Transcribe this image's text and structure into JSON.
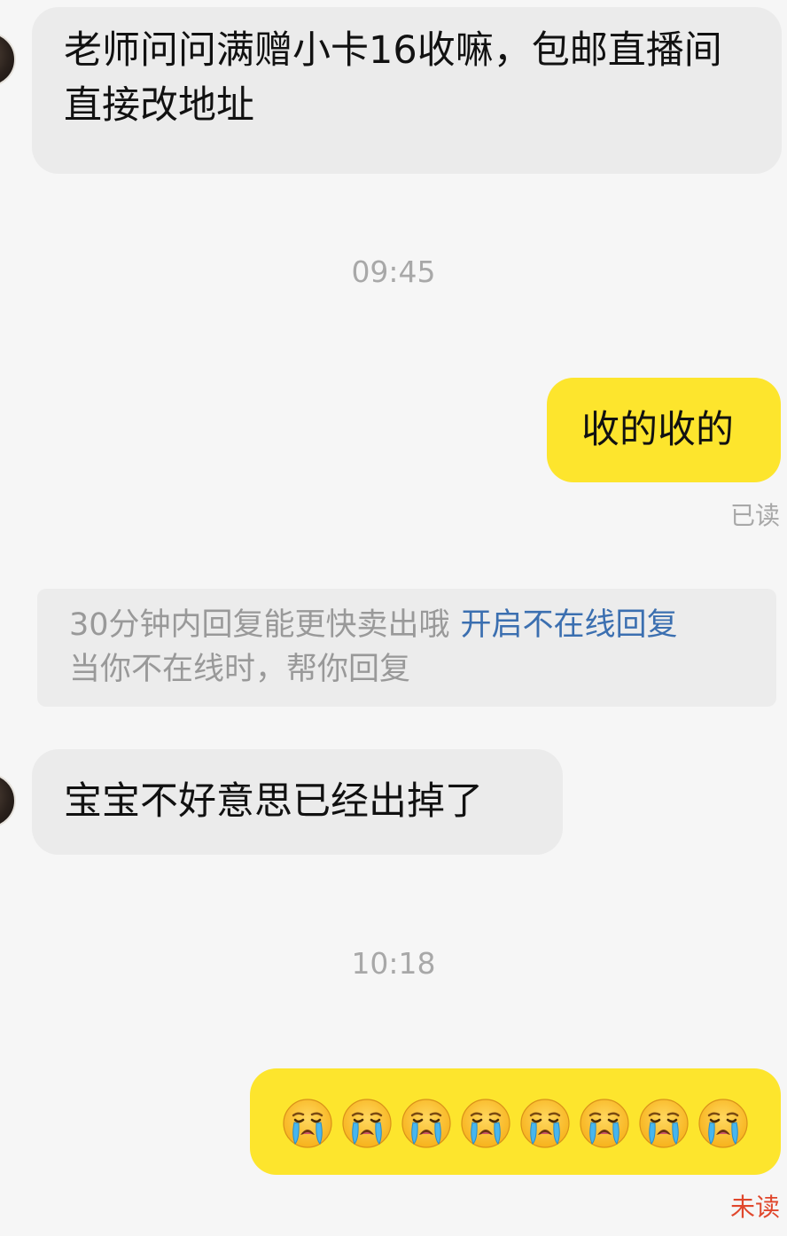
{
  "messages": {
    "m1": {
      "text": "老师问问满赠小卡16收嘛，包邮直播间直接改地址"
    },
    "t1": "09:45",
    "m2": {
      "text": "收的收的",
      "status": "已读"
    },
    "system": {
      "text": "30分钟内回复能更快卖出哦",
      "link": "开启不在线回复",
      "subtext": "当你不在线时，帮你回复"
    },
    "m3": {
      "text": "宝宝不好意思已经出掉了"
    },
    "t2": "10:18",
    "m4": {
      "emoji": [
        "loudly-crying-face",
        "loudly-crying-face",
        "loudly-crying-face",
        "loudly-crying-face",
        "loudly-crying-face",
        "loudly-crying-face",
        "loudly-crying-face",
        "loudly-crying-face"
      ],
      "status": "未读"
    }
  },
  "colors": {
    "background": "#f6f6f6",
    "incoming_bubble": "#ebebeb",
    "outgoing_bubble": "#fde52d",
    "read_status": "#a8a8a8",
    "unread_status": "#e0472c",
    "link": "#3b6fb0"
  }
}
